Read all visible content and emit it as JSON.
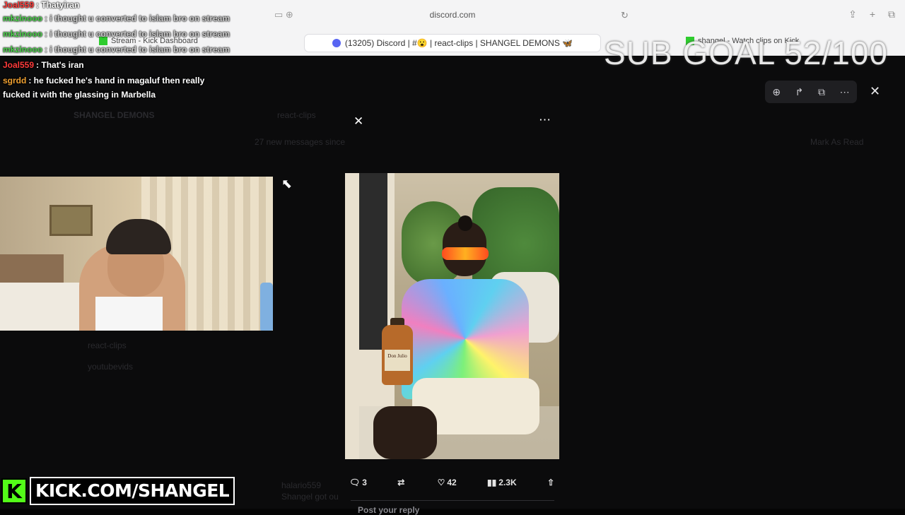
{
  "browser": {
    "url": "discord.com",
    "tab_discord": "(13205) Discord | #😮 | react-clips | SHANGEL DEMONS 🦋",
    "tab_kick_dashboard": "Stream - Kick Dashboard",
    "tab_kick_stream": "shangel - Watch clips on Kick"
  },
  "overlay": {
    "sub_goal": "SUB GOAL 52/100",
    "kick_banner": "KICK.COM/SHANGEL",
    "kick_logo": "K"
  },
  "chat": [
    {
      "user": "Joal559",
      "user_color": "#ff3b3b",
      "message": ": Thatyiran"
    },
    {
      "user": "mkzinooo",
      "user_color": "#4bd14b",
      "message": ": i thought u converted to islam bro on stream"
    },
    {
      "user": "mkzinooo",
      "user_color": "#4bd14b",
      "message": ": i thought u converted to islam bro on stream"
    },
    {
      "user": "mkzinooo",
      "user_color": "#4bd14b",
      "message": ": i thought u converted to islam bro on stream"
    },
    {
      "user": "Joal559",
      "user_color": "#ff3b3b",
      "message": ": That's iran"
    },
    {
      "user": "sgrdd",
      "user_color": "#f0a030",
      "message": ": he fucked he's hand in magaluf then really"
    },
    {
      "user": "",
      "user_color": "#ffffff",
      "message": "fucked it with the glassing in Marbella"
    }
  ],
  "discord_bg": {
    "server_name": "SHANGEL DEMONS",
    "channel": "react-clips",
    "new_messages": "27 new messages since",
    "mark_as_read": "Mark As Read",
    "channel_list": [
      "react-clips",
      "youtubevids"
    ],
    "poster": "halario559",
    "poster_msg": "Shangel got ou"
  },
  "image_viewer": {
    "tools": [
      "zoom-in-icon",
      "forward-icon",
      "open-external-icon",
      "more-icon"
    ]
  },
  "tweet": {
    "bottle_label": "Don Julio",
    "replies": "3",
    "retweets": "",
    "likes": "42",
    "views": "2.3K",
    "reply_placeholder": "Post your reply"
  }
}
